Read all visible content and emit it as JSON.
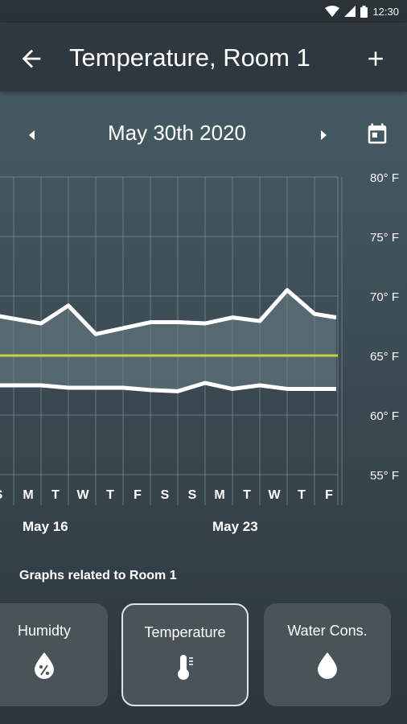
{
  "status_bar": {
    "time": "12:30"
  },
  "app_bar": {
    "title": "Temperature, Room 1"
  },
  "date_nav": {
    "date": "May 30th 2020"
  },
  "chart_data": {
    "type": "line",
    "y_ticks": [
      "80° F",
      "75° F",
      "70° F",
      "65° F",
      "60° F",
      "55° F"
    ],
    "x_tick_labels": [
      "S",
      "M",
      "T",
      "W",
      "T",
      "F",
      "S",
      "S",
      "M",
      "T",
      "W",
      "T",
      "F"
    ],
    "week_labels": [
      "May 16",
      "May 23"
    ],
    "ylim": [
      55,
      80
    ],
    "threshold": 65,
    "grid": true,
    "series": [
      {
        "values": [
          68.5,
          67.7,
          69.2,
          66.8,
          67.3,
          67.8,
          67.8,
          67.7,
          68.2,
          67.9,
          70.5,
          68.5,
          68.2
        ]
      },
      {
        "values": [
          62.5,
          62.5,
          62.3,
          62.3,
          62.3,
          62.1,
          62.0,
          62.7,
          62.2,
          62.5,
          62.2,
          62.2,
          62.2
        ]
      }
    ],
    "colors": {
      "line": "#ffffff",
      "threshold": "#c6d33a",
      "grid": "#8a9aa1",
      "fill": "#6b7f87"
    }
  },
  "related": {
    "title": "Graphs related to Room 1",
    "cards": [
      {
        "label": "Humidty",
        "icon": "humidity-drop-icon"
      },
      {
        "label": "Temperature",
        "icon": "thermometer-icon"
      },
      {
        "label": "Water Cons.",
        "icon": "water-drop-icon"
      }
    ]
  }
}
